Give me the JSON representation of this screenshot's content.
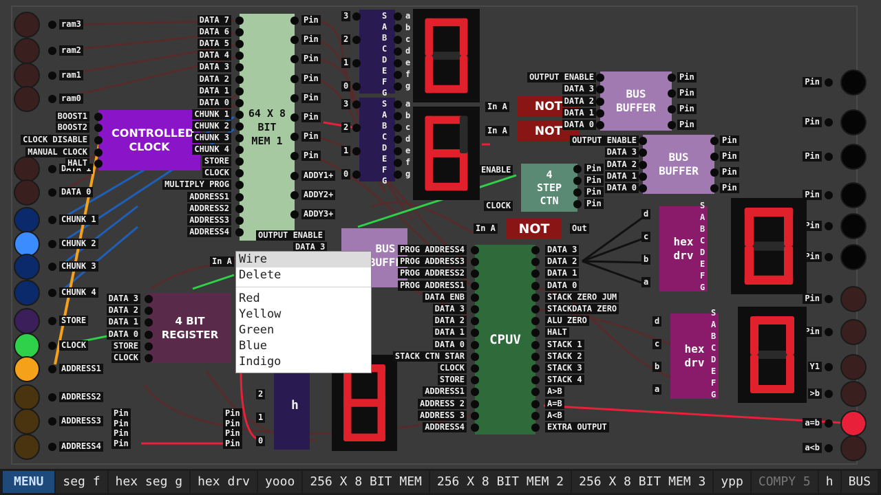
{
  "left_inputs": [
    {
      "label": "ram3",
      "color": "#3a1f1f"
    },
    {
      "label": "ram2",
      "color": "#3a1f1f"
    },
    {
      "label": "ram1",
      "color": "#3a1f1f"
    },
    {
      "label": "ram0",
      "color": "#3a1f1f"
    },
    {
      "label": "DATA 1",
      "color": "#3a1f1f"
    },
    {
      "label": "DATA 0",
      "color": "#3a1f1f"
    },
    {
      "label": "CHUNK 1",
      "color": "#0b2a6b"
    },
    {
      "label": "CHUNK 2",
      "color": "#3a8cff"
    },
    {
      "label": "CHUNK 3",
      "color": "#0b2a6b"
    },
    {
      "label": "CHUNK 4",
      "color": "#0b2a6b"
    },
    {
      "label": "STORE",
      "color": "#3a1f5a"
    },
    {
      "label": "CLOCK",
      "color": "#2fd14a"
    },
    {
      "label": "ADDRESS1",
      "color": "#f5a21a"
    },
    {
      "label": "ADDRESS2",
      "color": "#4a3410"
    },
    {
      "label": "ADDRESS3",
      "color": "#4a3410"
    },
    {
      "label": "ADDRESS4",
      "color": "#4a3410"
    }
  ],
  "controlled_clock": {
    "title": "CONTROLLED CLOCK",
    "inputs": [
      "BOOST1",
      "BOOST2",
      "CLOCK DISABLE",
      "MANUAL CLOCK",
      "HALT"
    ]
  },
  "mem": {
    "title": "64 X 8 BIT MEM 1",
    "inputs": [
      "DATA 7",
      "DATA 6",
      "DATA 5",
      "DATA 4",
      "DATA 3",
      "DATA 2",
      "DATA 1",
      "DATA 0",
      "CHUNK 1",
      "CHUNK 2",
      "CHUNK 3",
      "CHUNK 4",
      "STORE",
      "CLOCK",
      "MULTIPLY PROG",
      "ADDRESS1",
      "ADDRESS2",
      "ADDRESS3",
      "ADDRESS4"
    ],
    "outputs": [
      "Pin",
      "Pin",
      "Pin",
      "Pin",
      "Pin",
      "Pin",
      "Pin",
      "Pin",
      "ADDY1+",
      "ADDY2+",
      "ADDY3+"
    ]
  },
  "hex_pins_in": [
    "S",
    "A",
    "B",
    "C",
    "D",
    "E",
    "F",
    "G"
  ],
  "hex_pins_out": [
    "a",
    "b",
    "c",
    "d",
    "e",
    "f",
    "g"
  ],
  "digits": [
    "0",
    "6",
    "0",
    "0",
    "8"
  ],
  "num_labels_top": [
    "3",
    "2",
    "1",
    "0"
  ],
  "num_labels_mid": [
    "3",
    "2",
    "1",
    "0"
  ],
  "not_gates": [
    {
      "in": "In A",
      "label": "NOT",
      "out": "Out"
    }
  ],
  "bus_buffer": {
    "title": "BUS BUFFER",
    "inputs": [
      "OUTPUT ENABLE",
      "DATA 3",
      "DATA 2",
      "DATA 1",
      "DATA 0"
    ],
    "out": "Pin"
  },
  "step_ctn": {
    "title": "4 STEP CTN",
    "inputs": [
      "ENABLE",
      "CLOCK"
    ],
    "out": "Pin"
  },
  "hex_drv": {
    "title": "hex drv",
    "inputs": [
      "d",
      "c",
      "b",
      "a"
    ]
  },
  "cpuv": {
    "title": "CPUV",
    "inputs": [
      "PROG ADDRESS4",
      "PROG ADDRESS3",
      "PROG ADDRESS2",
      "PROG ADDRESS1",
      "DATA ENB",
      "DATA 3",
      "DATA 2",
      "DATA 1",
      "DATA 0",
      "STACK CTN STAR",
      "CLOCK",
      "STORE",
      "ADDRESS1",
      "ADDRESS 2",
      "ADDRESS 3",
      "ADDRESS4"
    ],
    "outputs": [
      "DATA 3",
      "DATA 2",
      "DATA 1",
      "DATA 0",
      "STACK ZERO JUM",
      "STACKDATA ZERO",
      "ALU ZERO",
      "HALT",
      "STACK 1",
      "STACK 2",
      "STACK 3",
      "STACK 4",
      "A>B",
      "A=B",
      "A<B",
      "EXTRA OUTPUT"
    ]
  },
  "register": {
    "title": "4 BIT REGISTER",
    "inputs": [
      "DATA 3",
      "DATA 2",
      "DATA 1",
      "DATA 0",
      "STORE",
      "CLOCK"
    ]
  },
  "right_outputs": [
    {
      "label": "Pin",
      "color": "#050505"
    },
    {
      "label": "Pin",
      "color": "#050505"
    },
    {
      "label": "Pin",
      "color": "#050505"
    },
    {
      "label": "Pin",
      "color": "#050505"
    },
    {
      "label": "Pin",
      "color": "#050505"
    },
    {
      "label": "Pin",
      "color": "#050505"
    },
    {
      "label": "Pin",
      "color": "#3a1f1f"
    },
    {
      "label": "Pin",
      "color": "#3a1f1f"
    },
    {
      "label": "Y1",
      "color": "#3a1f1f"
    },
    {
      "label": ">b",
      "color": "#3a1f1f"
    },
    {
      "label": "a=b",
      "color": "#e8203a"
    },
    {
      "label": "a<b",
      "color": "#3a1f1f"
    }
  ],
  "bottom_pins": [
    "Pin",
    "Pin",
    "Pin",
    "Pin"
  ],
  "context_menu": {
    "items": [
      "Wire",
      "Delete"
    ],
    "colors": [
      "Red",
      "Yellow",
      "Green",
      "Blue",
      "Indigo"
    ]
  },
  "taskbar": {
    "menu": "MENU",
    "items": [
      "seg f",
      "hex seg g",
      "hex drv",
      "yooo",
      "256 X 8 BIT MEM",
      "256 X 8 BIT MEM 2",
      "256 X 8 BIT MEM 3",
      "ypp",
      "COMPY 5",
      "h",
      "BUS"
    ]
  },
  "misc": {
    "bus_partial": "BUS\nBUFFE",
    "in_a": "In A",
    "output_enable": "OUTPUT ENABLE",
    "data3": "DATA 3",
    "h": "h"
  }
}
